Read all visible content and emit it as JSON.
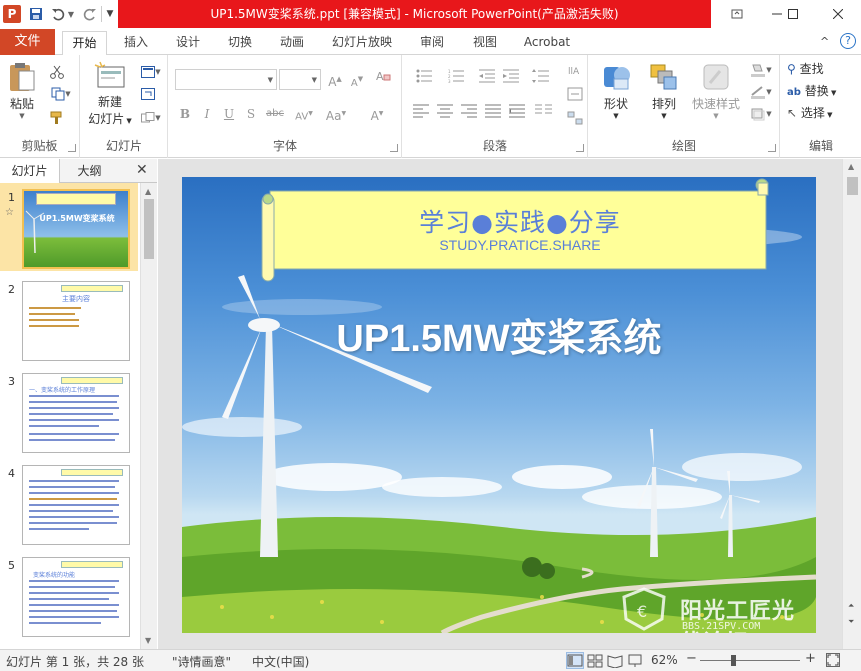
{
  "window": {
    "title": "UP1.5MW变桨系统.ppt [兼容模式] - Microsoft PowerPoint(产品激活失败)",
    "app_logo": "P",
    "help_glyph": "?"
  },
  "tabs": {
    "file": "文件",
    "items": [
      "开始",
      "插入",
      "设计",
      "切换",
      "动画",
      "幻灯片放映",
      "审阅",
      "视图",
      "Acrobat"
    ],
    "active": "开始"
  },
  "ribbon": {
    "clipboard": {
      "label": "剪贴板",
      "paste": "粘贴"
    },
    "slides": {
      "label": "幻灯片",
      "new_slide": "新建\n幻灯片",
      "new_slide_line1": "新建",
      "new_slide_line2": "幻灯片"
    },
    "font": {
      "label": "字体",
      "font_name": "",
      "font_size": ""
    },
    "paragraph": {
      "label": "段落"
    },
    "drawing": {
      "label": "绘图",
      "shapes": "形状",
      "arrange": "排列",
      "quick_styles": "快速样式"
    },
    "editing": {
      "label": "编辑",
      "find": "查找",
      "replace": "替换",
      "select": "选择"
    }
  },
  "left_pane": {
    "tab_slides": "幻灯片",
    "tab_outline": "大纲",
    "close_glyph": "✕",
    "thumbnails": [
      {
        "number": "1",
        "selected": true,
        "title": "UP1.5MW变桨系统"
      },
      {
        "number": "2",
        "selected": false,
        "title": "主要内容"
      },
      {
        "number": "3",
        "selected": false,
        "title": "一、变桨系统的工作原理"
      },
      {
        "number": "4",
        "selected": false,
        "title": ""
      },
      {
        "number": "5",
        "selected": false,
        "title": "变桨系统的功能"
      }
    ]
  },
  "slide": {
    "banner_title": "学习●实践●分享",
    "banner_subtitle": "STUDY.PRATICE.SHARE",
    "title": "UP1.5MW变桨系统",
    "watermark_text": "阳光工匠光伏论坛",
    "watermark_url": "BBS.21SPV.COM"
  },
  "status": {
    "slide_info": "幻灯片 第 1 张，共 28 张",
    "theme": "\"诗情画意\"",
    "language": "中文(中国)",
    "zoom": "62%",
    "zoom_level": 0.62
  },
  "colors": {
    "title_bar_red": "#e8171b",
    "file_tab": "#d24726",
    "selected_thumb": "#fce4a6",
    "banner_text": "#5a7fd8"
  }
}
